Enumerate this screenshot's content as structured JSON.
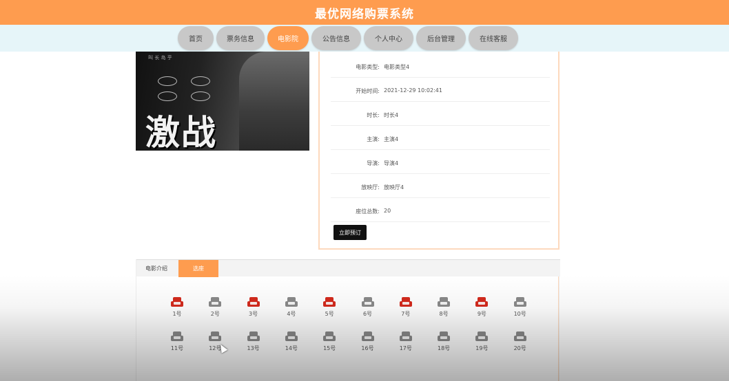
{
  "header": {
    "title": "最优网络购票系统"
  },
  "nav": {
    "items": [
      {
        "label": "首页",
        "active": false
      },
      {
        "label": "票务信息",
        "active": false
      },
      {
        "label": "电影院",
        "active": true
      },
      {
        "label": "公告信息",
        "active": false
      },
      {
        "label": "个人中心",
        "active": false
      },
      {
        "label": "后台管理",
        "active": false
      },
      {
        "label": "在线客服",
        "active": false
      }
    ]
  },
  "poster": {
    "title": "激战",
    "small_text": "叫 长 岛 乎"
  },
  "details": {
    "rows": [
      {
        "label": "电影类型:",
        "value": "电影类型4"
      },
      {
        "label": "开始时间:",
        "value": "2021-12-29 10:02:41"
      },
      {
        "label": "时长:",
        "value": "时长4"
      },
      {
        "label": "主演:",
        "value": "主演4"
      },
      {
        "label": "导演:",
        "value": "导演4"
      },
      {
        "label": "放映厅:",
        "value": "放映厅4"
      },
      {
        "label": "座位总数:",
        "value": "20"
      }
    ],
    "book_button": "立即预订"
  },
  "tabs": [
    {
      "label": "电影介绍",
      "active": false
    },
    {
      "label": "选座",
      "active": true
    }
  ],
  "seats": [
    {
      "label": "1号",
      "status": "sold"
    },
    {
      "label": "2号",
      "status": "free"
    },
    {
      "label": "3号",
      "status": "sold"
    },
    {
      "label": "4号",
      "status": "free"
    },
    {
      "label": "5号",
      "status": "sold"
    },
    {
      "label": "6号",
      "status": "free"
    },
    {
      "label": "7号",
      "status": "sold"
    },
    {
      "label": "8号",
      "status": "free"
    },
    {
      "label": "9号",
      "status": "sold"
    },
    {
      "label": "10号",
      "status": "free"
    },
    {
      "label": "11号",
      "status": "free"
    },
    {
      "label": "12号",
      "status": "free"
    },
    {
      "label": "13号",
      "status": "free"
    },
    {
      "label": "14号",
      "status": "free"
    },
    {
      "label": "15号",
      "status": "free"
    },
    {
      "label": "16号",
      "status": "free"
    },
    {
      "label": "17号",
      "status": "free"
    },
    {
      "label": "18号",
      "status": "free"
    },
    {
      "label": "19号",
      "status": "free"
    },
    {
      "label": "20号",
      "status": "free"
    }
  ],
  "colors": {
    "accent": "#fe9c4f",
    "sold": "#d42a1d",
    "free": "#8a8a8a",
    "nav_bg": "#e6f5f9"
  }
}
